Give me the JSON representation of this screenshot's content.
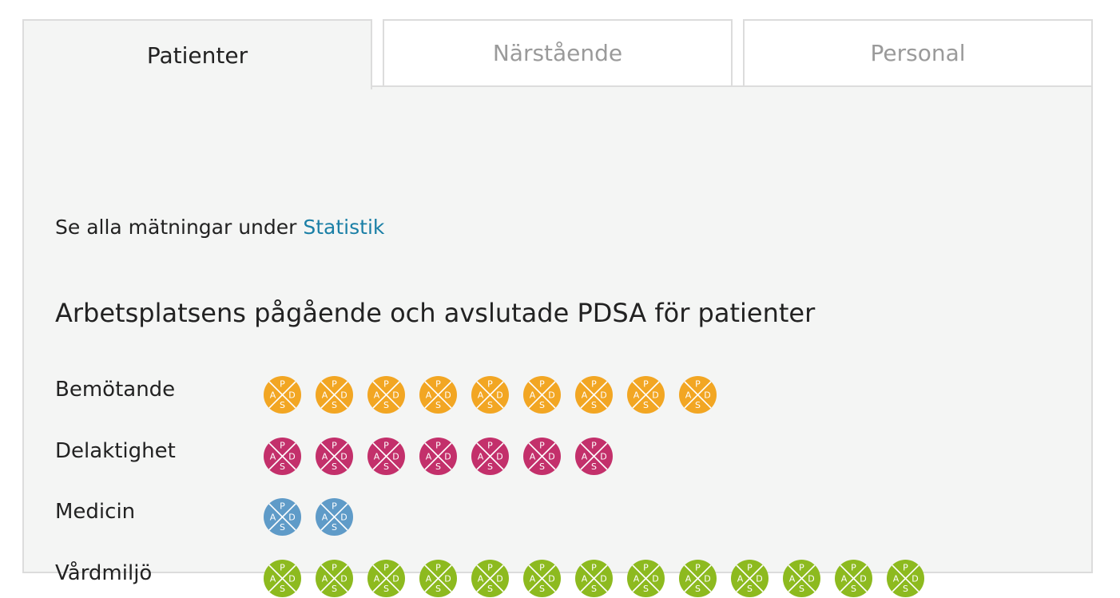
{
  "tabs": [
    {
      "label": "Patienter",
      "active": true
    },
    {
      "label": "Närstående",
      "active": false
    },
    {
      "label": "Personal",
      "active": false
    }
  ],
  "panel": {
    "info_text": "Se alla mätningar under",
    "info_link": "Statistik",
    "heading": "Arbetsplatsens pågående och avslutade PDSA för patienter",
    "pdsa_letters": {
      "top": "P",
      "left": "A",
      "right": "D",
      "bottom": "S"
    },
    "categories": [
      {
        "label": "Bemötande",
        "count": 9,
        "color": "#f2a623"
      },
      {
        "label": "Delaktighet",
        "count": 7,
        "color": "#c3306b"
      },
      {
        "label": "Medicin",
        "count": 2,
        "color": "#5f9bc8"
      },
      {
        "label": "Vårdmiljö",
        "count": 13,
        "color": "#8dba1f"
      }
    ]
  }
}
